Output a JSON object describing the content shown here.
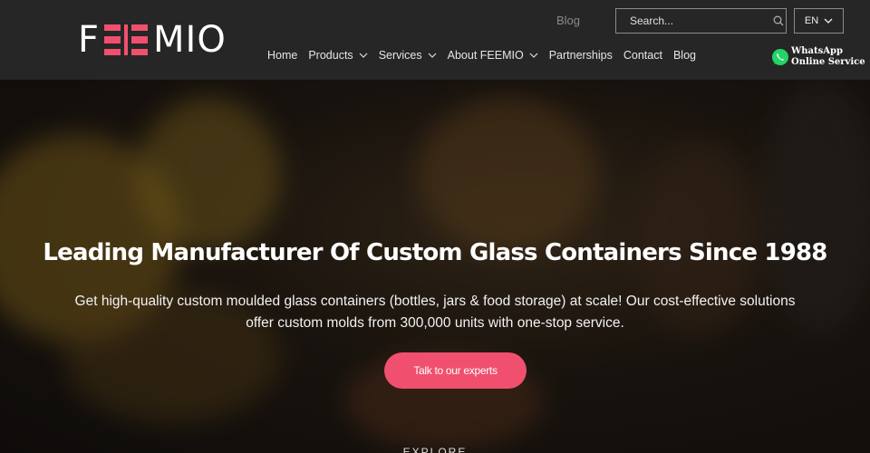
{
  "header": {
    "logo_text": {
      "first": "F",
      "rest": "MIO"
    },
    "top_blog": "Blog",
    "search_placeholder": "Search...",
    "language": "EN",
    "nav": [
      {
        "label": "Home",
        "has_dropdown": false
      },
      {
        "label": "Products",
        "has_dropdown": true
      },
      {
        "label": "Services",
        "has_dropdown": true
      },
      {
        "label": "About FEEMIO",
        "has_dropdown": true
      },
      {
        "label": "Partnerships",
        "has_dropdown": false
      },
      {
        "label": "Contact",
        "has_dropdown": false
      },
      {
        "label": "Blog",
        "has_dropdown": false
      }
    ],
    "whatsapp": {
      "line1": "WhatsApp",
      "line2": "Online Service",
      "icon": "whatsapp-icon"
    }
  },
  "hero": {
    "title": "Leading Manufacturer Of Custom Glass Containers Since 1988",
    "subtitle": "Get high-quality custom moulded glass containers (bottles, jars & food storage) at scale! Our cost-effective solutions offer custom molds from 300,000 units with one-stop service.",
    "cta": "Talk to our experts",
    "explore": "EXPLORE"
  },
  "colors": {
    "brand_pink": "#f0506e",
    "header_bg": "#262626",
    "whatsapp_green": "#25d366"
  }
}
